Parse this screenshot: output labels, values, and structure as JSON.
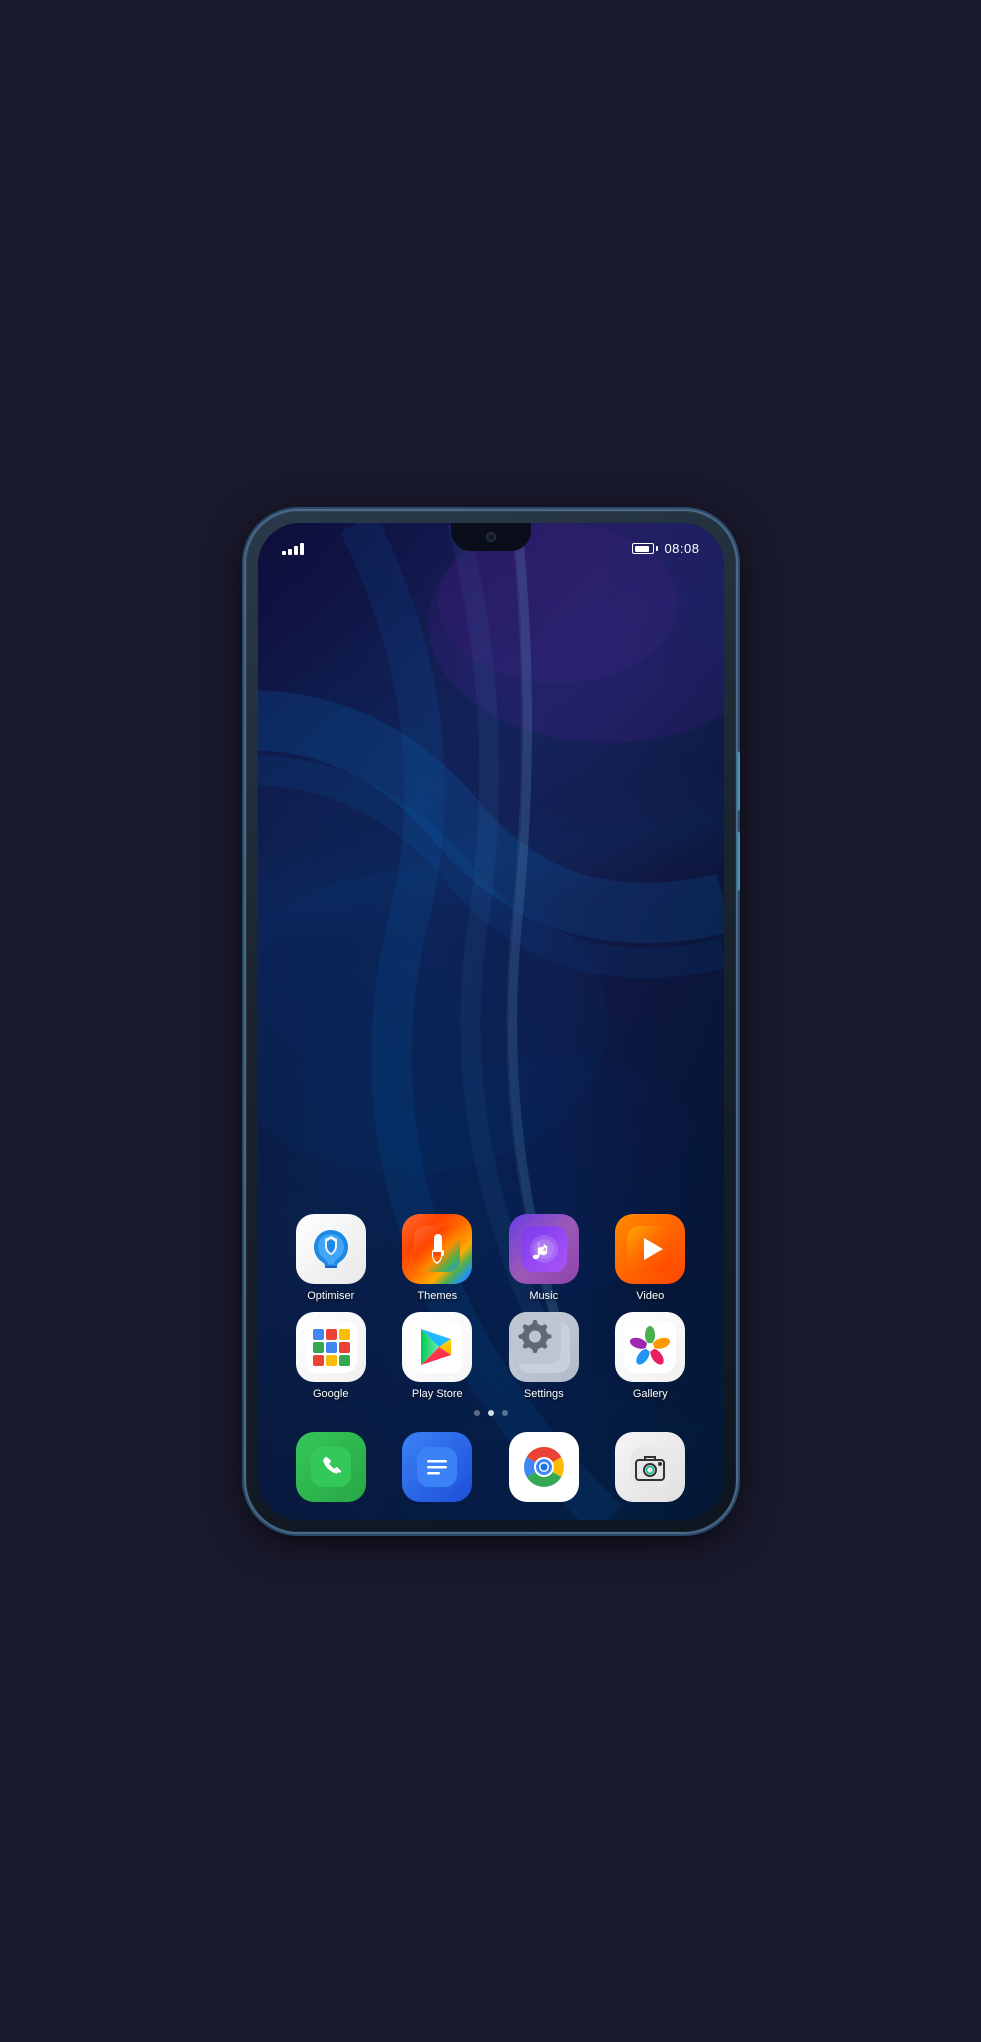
{
  "statusBar": {
    "time": "08:08",
    "signalBars": 4,
    "batteryLevel": 85
  },
  "appGrid": {
    "row1": [
      {
        "id": "optimiser",
        "label": "Optimiser",
        "iconType": "optimiser"
      },
      {
        "id": "themes",
        "label": "Themes",
        "iconType": "themes"
      },
      {
        "id": "music",
        "label": "Music",
        "iconType": "music"
      },
      {
        "id": "video",
        "label": "Video",
        "iconType": "video"
      }
    ],
    "row2": [
      {
        "id": "google",
        "label": "Google",
        "iconType": "google"
      },
      {
        "id": "playstore",
        "label": "Play Store",
        "iconType": "playstore"
      },
      {
        "id": "settings",
        "label": "Settings",
        "iconType": "settings"
      },
      {
        "id": "gallery",
        "label": "Gallery",
        "iconType": "gallery"
      }
    ]
  },
  "pageDots": [
    false,
    true,
    false
  ],
  "dock": [
    {
      "id": "phone",
      "label": "Phone",
      "iconType": "phone"
    },
    {
      "id": "messages",
      "label": "Messages",
      "iconType": "messages"
    },
    {
      "id": "chrome",
      "label": "Chrome",
      "iconType": "chrome"
    },
    {
      "id": "camera",
      "label": "Camera",
      "iconType": "camera"
    }
  ]
}
